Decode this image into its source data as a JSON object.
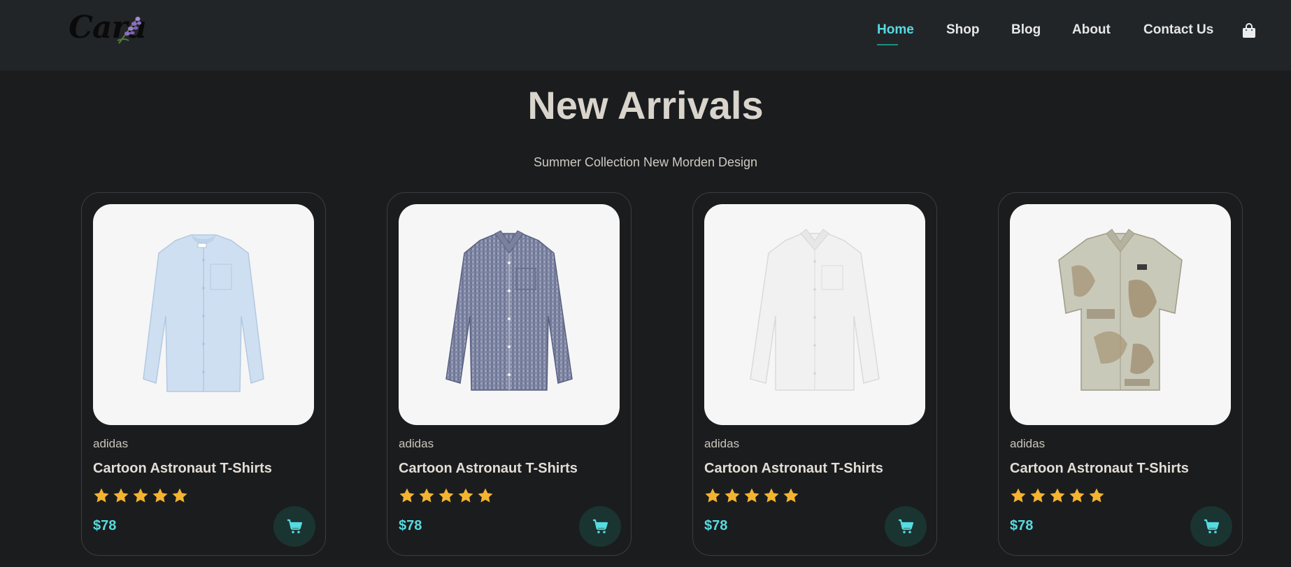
{
  "header": {
    "logo_text": "Cara",
    "nav": [
      {
        "label": "Home",
        "active": true
      },
      {
        "label": "Shop",
        "active": false
      },
      {
        "label": "Blog",
        "active": false
      },
      {
        "label": "About",
        "active": false
      },
      {
        "label": "Contact Us",
        "active": false
      }
    ],
    "cart_icon": "shopping-bag-icon"
  },
  "section": {
    "title": "New Arrivals",
    "subtitle": "Summer Collection New Morden Design"
  },
  "products": [
    {
      "brand": "adidas",
      "name": "Cartoon Astronaut T-Shirts",
      "rating": 5,
      "price": "$78",
      "image": "light-blue-long-sleeve-shirt"
    },
    {
      "brand": "adidas",
      "name": "Cartoon Astronaut T-Shirts",
      "rating": 5,
      "price": "$78",
      "image": "navy-gingham-long-sleeve-shirt"
    },
    {
      "brand": "adidas",
      "name": "Cartoon Astronaut T-Shirts",
      "rating": 5,
      "price": "$78",
      "image": "white-long-sleeve-shirt"
    },
    {
      "brand": "adidas",
      "name": "Cartoon Astronaut T-Shirts",
      "rating": 5,
      "price": "$78",
      "image": "printed-short-sleeve-shirt"
    }
  ],
  "colors": {
    "accent": "#56dbe1",
    "star": "#f3b430",
    "background": "#1b1c1e",
    "header": "#222528",
    "cart_button": "#1a3431"
  }
}
